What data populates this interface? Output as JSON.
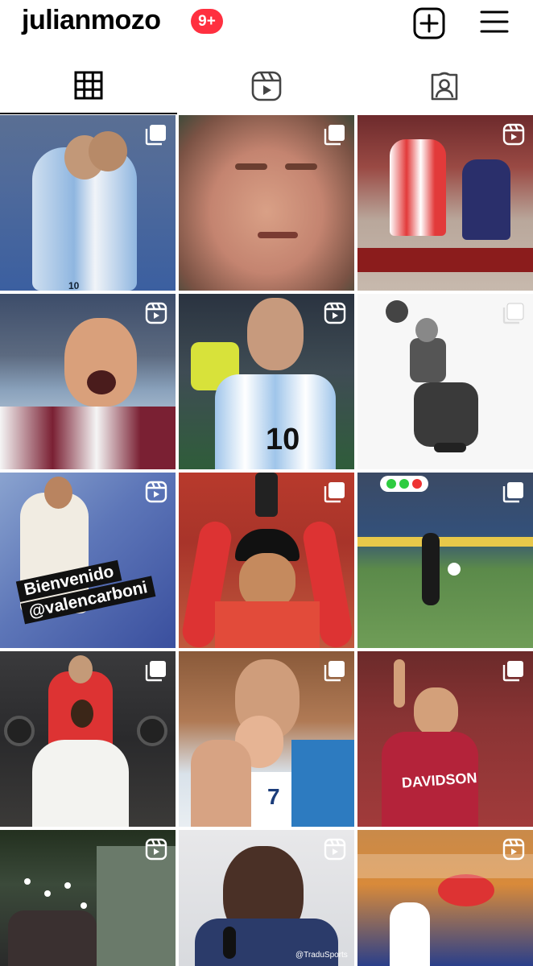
{
  "header": {
    "username": "julianmozo",
    "notification_badge": "9+",
    "new_post_icon": "plus-square-icon",
    "menu_icon": "hamburger-menu-icon"
  },
  "tabs": [
    {
      "name": "grid",
      "icon": "grid-icon",
      "active": true
    },
    {
      "name": "reels",
      "icon": "reels-icon",
      "active": false
    },
    {
      "name": "tagged",
      "icon": "tagged-person-icon",
      "active": false
    }
  ],
  "posts": [
    {
      "type": "carousel",
      "caption_overlay": ""
    },
    {
      "type": "carousel",
      "caption_overlay": ""
    },
    {
      "type": "reel",
      "caption_overlay": ""
    },
    {
      "type": "reel",
      "caption_overlay": ""
    },
    {
      "type": "reel",
      "caption_overlay": ""
    },
    {
      "type": "carousel",
      "caption_overlay": ""
    },
    {
      "type": "reel",
      "caption_overlay": "Bienvenido\n@valencarboni"
    },
    {
      "type": "carousel",
      "caption_overlay": ""
    },
    {
      "type": "carousel",
      "caption_overlay": ""
    },
    {
      "type": "carousel",
      "caption_overlay": ""
    },
    {
      "type": "carousel",
      "caption_overlay": ""
    },
    {
      "type": "carousel",
      "caption_overlay": ""
    },
    {
      "type": "reel",
      "caption_overlay": ""
    },
    {
      "type": "reel",
      "caption_overlay": "@TraduSports"
    },
    {
      "type": "reel",
      "caption_overlay": ""
    }
  ],
  "overlay_texts": {
    "jersey_number": "10",
    "welcome_line1": "Bienvenido",
    "welcome_line2": "@valencarboni",
    "watermark": "@TraduSports",
    "college_jersey": "DAVIDSON",
    "jersey_7": "7"
  },
  "colors": {
    "badge": "#ff3040",
    "text": "#000000",
    "background": "#ffffff"
  }
}
